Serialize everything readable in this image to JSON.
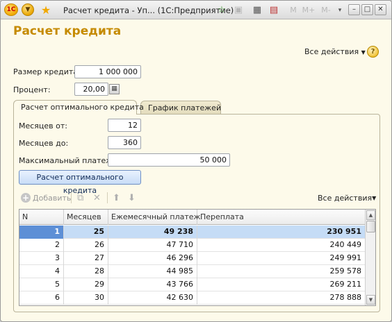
{
  "window": {
    "title": "Расчет кредита - Уп...  (1С:Предприятие)",
    "toolbar_icons": [
      "1c-logo-icon",
      "main-menu-icon",
      "favorites-star-icon",
      "add-favorite-icon",
      "history-icon",
      "calculator-icon",
      "calendar-icon",
      "memory-m-icon",
      "memory-plus-icon",
      "memory-minus-icon",
      "dropdown-arrow-icon",
      "minimize-icon",
      "maximize-icon",
      "close-icon"
    ],
    "m_labels": [
      "M",
      "M+",
      "M-"
    ]
  },
  "header": {
    "title": "Расчет кредита",
    "all_actions": "Все действия",
    "help": "?"
  },
  "form": {
    "loan_size_label": "Размер кредита:",
    "loan_size_value": "1 000 000",
    "percent_label": "Процент:",
    "percent_value": "20,00"
  },
  "tabs": [
    {
      "label": "Расчет оптимального кредита",
      "active": true
    },
    {
      "label": "График платежей",
      "active": false
    }
  ],
  "optimal": {
    "months_from_label": "Месяцев от:",
    "months_from_value": "12",
    "months_to_label": "Месяцев до:",
    "months_to_value": "360",
    "max_payment_label": "Максимальный платеж:",
    "max_payment_value": "50 000",
    "calc_button": "Расчет оптимального кредита"
  },
  "table_toolbar": {
    "add_label": "Добавить",
    "all_actions": "Все действия"
  },
  "table": {
    "columns": [
      "N",
      "Месяцев",
      "Ежемесячный платеж",
      "Переплата"
    ],
    "rows": [
      {
        "n": "1",
        "months": "25",
        "payment": "49 238",
        "overpay": "230 951",
        "selected": true
      },
      {
        "n": "2",
        "months": "26",
        "payment": "47 710",
        "overpay": "240 449"
      },
      {
        "n": "3",
        "months": "27",
        "payment": "46 296",
        "overpay": "249 991"
      },
      {
        "n": "4",
        "months": "28",
        "payment": "44 985",
        "overpay": "259 578"
      },
      {
        "n": "5",
        "months": "29",
        "payment": "43 766",
        "overpay": "269 211"
      },
      {
        "n": "6",
        "months": "30",
        "payment": "42 630",
        "overpay": "278 888"
      }
    ]
  },
  "colors": {
    "title_accent": "#c58a00",
    "selection": "#c5dcf6",
    "selected_n": "#5d8fd6",
    "background": "#fdfaea"
  }
}
